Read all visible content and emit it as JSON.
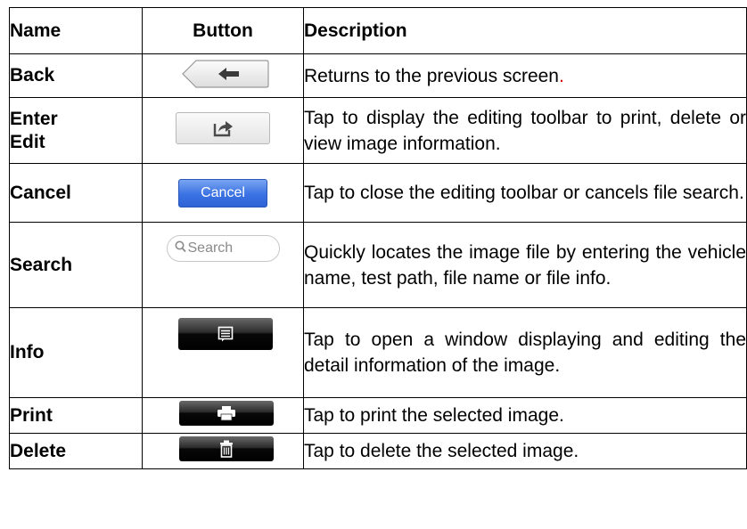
{
  "table": {
    "headers": {
      "name": "Name",
      "button": "Button",
      "description": "Description"
    },
    "rows": [
      {
        "name": "Back",
        "button_icon": "back-arrow-icon",
        "description": "Returns to the previous screen",
        "description_end": "."
      },
      {
        "name": "Enter Edit",
        "button_icon": "share-edit-icon",
        "description": "Tap to display the editing toolbar to print, delete or view image information."
      },
      {
        "name": "Cancel",
        "button_label": "Cancel",
        "description": "Tap to close the editing toolbar or cancels file search."
      },
      {
        "name": "Search",
        "button_icon": "magnifier-icon",
        "button_placeholder": "Search",
        "description": "Quickly locates the image file by entering the vehicle name, test path, file name or file info."
      },
      {
        "name": "Info",
        "button_icon": "info-document-icon",
        "description": "Tap to open a window displaying and editing the detail information of the image."
      },
      {
        "name": "Print",
        "button_icon": "printer-icon",
        "description": "Tap to print the selected image."
      },
      {
        "name": "Delete",
        "button_icon": "trash-icon",
        "description": "Tap to delete the selected image."
      }
    ]
  },
  "colors": {
    "cancel_button": "#3a71e3",
    "dark_button": "#000000",
    "period_accent": "#d40000"
  }
}
